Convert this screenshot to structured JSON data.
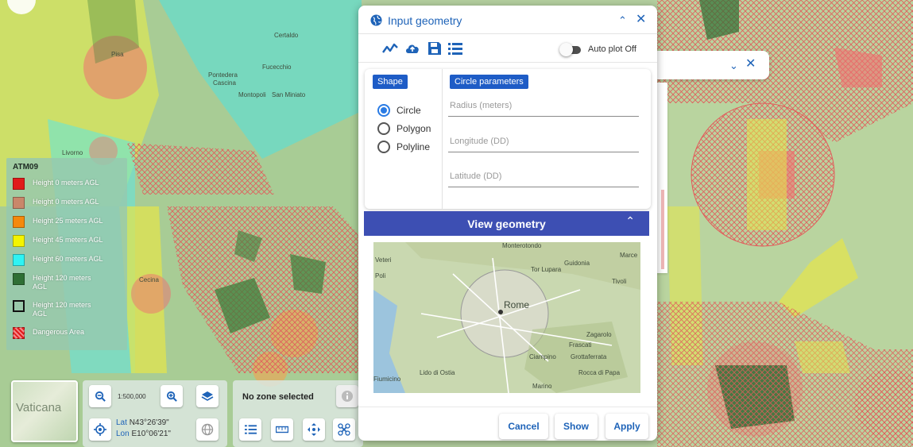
{
  "map": {
    "place_labels": [
      "Pisa",
      "Livorno",
      "Cascina",
      "Pontedera",
      "Fucecchio",
      "Montopoli",
      "San Miniato",
      "Certaldo",
      "Cecina",
      "Vaticana"
    ]
  },
  "legend": {
    "title": "ATM09",
    "items": [
      {
        "label": "Height 0 meters AGL",
        "color": "#e11b1b"
      },
      {
        "label": "Height 0 meters AGL",
        "color": "#c9876a"
      },
      {
        "label": "Height 25 meters AGL",
        "color": "#f5890c"
      },
      {
        "label": "Height 45 meters AGL",
        "color": "#f4f400"
      },
      {
        "label": "Height 60 meters AGL",
        "color": "#2ff3f3"
      },
      {
        "label": "Height 120 meters AGL",
        "color": "#2f6f35"
      },
      {
        "label": "Height 120 meters AGL",
        "color": "#ffffff"
      },
      {
        "label": "Dangerous Area",
        "color": "#e11b1b"
      }
    ]
  },
  "map_controls": {
    "mini_map_label": "Vaticana",
    "scale": "1:500,000",
    "lat_label": "Lat",
    "lat_value": "N43°26'39\"",
    "lon_label": "Lon",
    "lon_value": "E10°06'21\""
  },
  "zone_panel": {
    "title": "No zone selected"
  },
  "dialog": {
    "title": "Input geometry",
    "auto_plot_label": "Auto plot Off",
    "auto_plot_on": false,
    "shape_chip": "Shape",
    "params_chip": "Circle parameters",
    "shape_options": [
      {
        "label": "Circle",
        "checked": true
      },
      {
        "label": "Polygon",
        "checked": false
      },
      {
        "label": "Polyline",
        "checked": false
      }
    ],
    "fields": {
      "radius_placeholder": "Radius (meters)",
      "longitude_placeholder": "Longitude (DD)",
      "latitude_placeholder": "Latitude (DD)"
    },
    "view_geometry_title": "View geometry",
    "preview_map_labels": [
      "Monterotondo",
      "Guidonia",
      "Marce",
      "Veteri",
      "Tor Lupara",
      "Tivoli",
      "Poli",
      "Rome",
      "Zagarolo",
      "Frascati",
      "Ciampino",
      "Grottaferrata",
      "Rocca di Papa",
      "Lido di Ostia",
      "Fiumicino",
      "Marino"
    ],
    "buttons": {
      "cancel": "Cancel",
      "show": "Show",
      "apply": "Apply"
    }
  },
  "colors": {
    "accent": "#1e63b8",
    "view_geometry_bar": "#3d4fb3",
    "chip": "#1e5cc6"
  }
}
